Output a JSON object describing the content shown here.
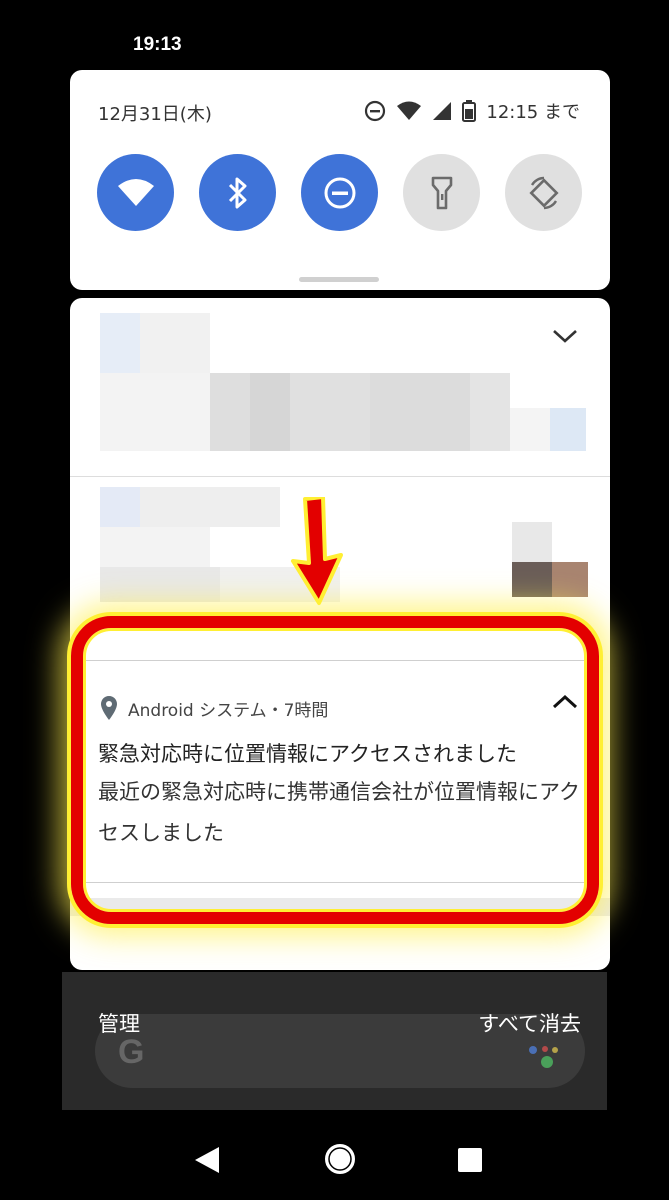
{
  "status_bar": {
    "time": "19:13"
  },
  "quick_settings": {
    "date": "12月31日(木)",
    "dnd_until": "12:15 まで",
    "tiles": [
      {
        "name": "wifi-icon",
        "on": true
      },
      {
        "name": "bluetooth-icon",
        "on": true
      },
      {
        "name": "do-not-disturb-icon",
        "on": true
      },
      {
        "name": "flashlight-icon",
        "on": false
      },
      {
        "name": "auto-rotate-icon",
        "on": false
      }
    ]
  },
  "notification": {
    "app_line": "Android システム・7時間",
    "title": "緊急対応時に位置情報にアクセスされました",
    "body": "最近の緊急対応時に携帯通信会社が位置情報にアクセスしました"
  },
  "footer": {
    "manage": "管理",
    "clear_all": "すべて消去"
  },
  "colors": {
    "accent": "#3f73d8",
    "highlight_red": "#e30000",
    "highlight_yellow": "#ffef33"
  }
}
